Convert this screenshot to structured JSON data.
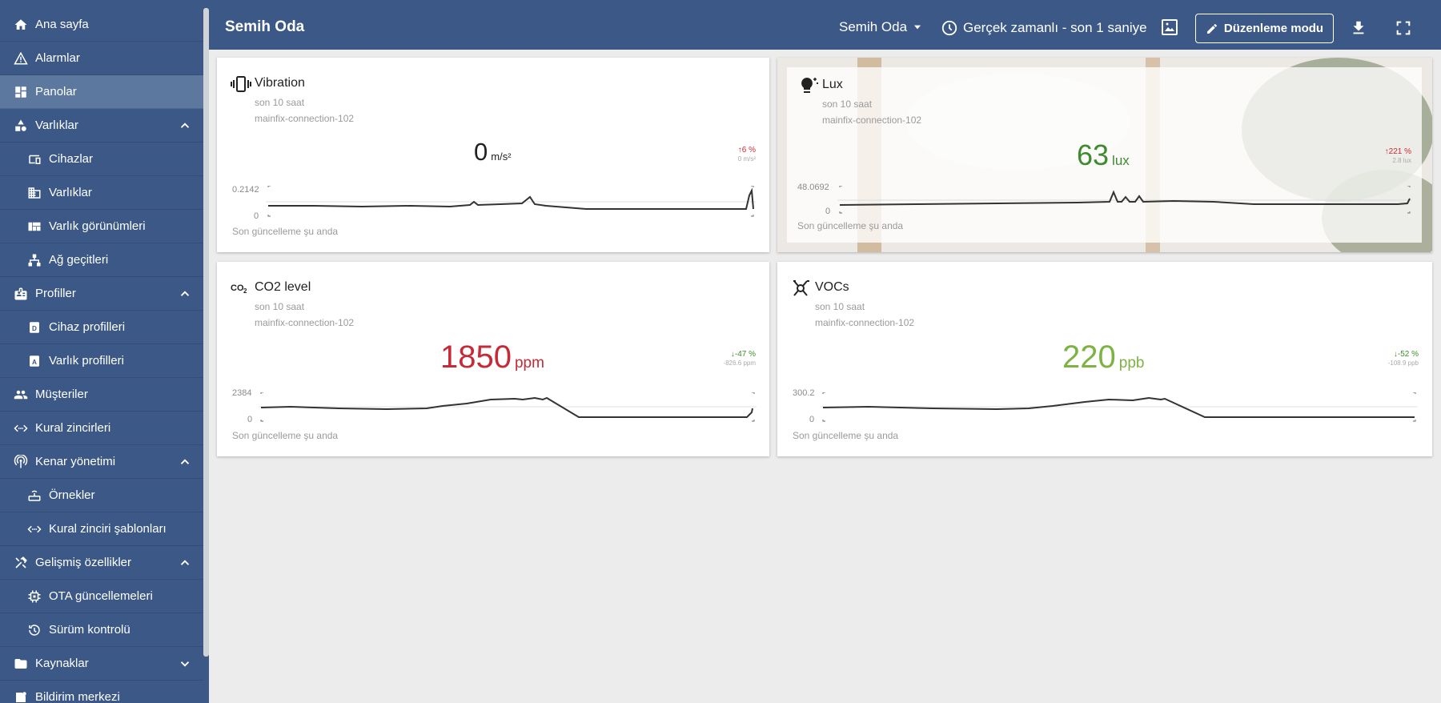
{
  "sidebar": {
    "items": [
      {
        "label": "Ana sayfa",
        "icon": "home-icon"
      },
      {
        "label": "Alarmlar",
        "icon": "warning-icon"
      },
      {
        "label": "Panolar",
        "icon": "dashboard-icon"
      },
      {
        "label": "Varlıklar",
        "icon": "shapes-icon"
      },
      {
        "label": "Cihazlar",
        "icon": "devices-icon"
      },
      {
        "label": "Varlıklar",
        "icon": "domain-icon"
      },
      {
        "label": "Varlık görünümleri",
        "icon": "view-quilt-icon"
      },
      {
        "label": "Ağ geçitleri",
        "icon": "lan-icon"
      },
      {
        "label": "Profiller",
        "icon": "badge-icon"
      },
      {
        "label": "Cihaz profilleri",
        "icon": "device-profile-icon"
      },
      {
        "label": "Varlık profilleri",
        "icon": "asset-profile-icon"
      },
      {
        "label": "Müşteriler",
        "icon": "people-icon"
      },
      {
        "label": "Kural zincirleri",
        "icon": "code-arrows-icon"
      },
      {
        "label": "Kenar yönetimi",
        "icon": "wifi-tethering-icon"
      },
      {
        "label": "Örnekler",
        "icon": "router-icon"
      },
      {
        "label": "Kural zinciri şablonları",
        "icon": "code-arrows-icon"
      },
      {
        "label": "Gelişmiş özellikler",
        "icon": "construction-icon"
      },
      {
        "label": "OTA güncellemeleri",
        "icon": "memory-icon"
      },
      {
        "label": "Sürüm kontrolü",
        "icon": "history-icon"
      },
      {
        "label": "Kaynaklar",
        "icon": "folder-icon"
      },
      {
        "label": "Bildirim merkezi",
        "icon": "notification-icon"
      }
    ]
  },
  "topbar": {
    "title": "Semih Oda",
    "state": "Semih Oda",
    "timewindow": "Gerçek zamanlı - son 1 saniye",
    "edit_label": "Düzenleme modu"
  },
  "cards": {
    "vibration": {
      "title": "Vibration",
      "subtitle": "son 10 saat",
      "device": "mainfix-connection-102",
      "value": "0",
      "unit": "m/s²",
      "delta": "6 %",
      "delta_sub": "0 m/s²",
      "ymax": "0.2142",
      "ymin": "0",
      "footer": "Son güncelleme şu anda",
      "value_color": "#222222",
      "delta_color": "#d12730"
    },
    "lux": {
      "title": "Lux",
      "subtitle": "son 10 saat",
      "device": "mainfix-connection-102",
      "value": "63",
      "unit": "lux",
      "delta": "221 %",
      "delta_sub": "2.8 lux",
      "ymax": "48.0692",
      "ymin": "0",
      "footer": "Son güncelleme şu anda",
      "value_color": "#3f8a2e",
      "delta_color": "#d12730"
    },
    "co2": {
      "title": "CO2 level",
      "subtitle": "son 10 saat",
      "device": "mainfix-connection-102",
      "value": "1850",
      "unit": "ppm",
      "delta": "-47 %",
      "delta_sub": "-826.6 ppm",
      "ymax": "2384",
      "ymin": "0",
      "footer": "Son güncelleme şu anda",
      "value_color": "#c62a36",
      "delta_color": "#3f8a2e"
    },
    "vocs": {
      "title": "VOCs",
      "subtitle": "son 10 saat",
      "device": "mainfix-connection-102",
      "value": "220",
      "unit": "ppb",
      "delta": "-52 %",
      "delta_sub": "-108.9 ppb",
      "ymax": "300.2",
      "ymin": "0",
      "footer": "Son güncelleme şu anda",
      "value_color": "#7cb342",
      "delta_color": "#3f8a2e"
    }
  }
}
